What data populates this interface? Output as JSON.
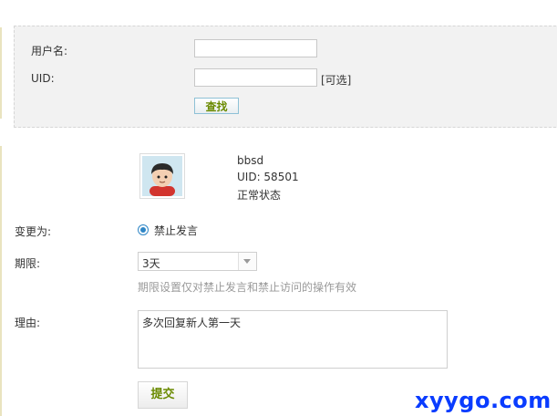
{
  "search": {
    "username_label": "用户名:",
    "username_value": "",
    "uid_label": "UID:",
    "uid_value": "",
    "uid_hint": "[可选]",
    "search_button": "查找"
  },
  "user": {
    "name": "bbsd",
    "uid": "UID: 58501",
    "status": "正常状态"
  },
  "form": {
    "change_label": "变更为:",
    "selected_action": "禁止发言",
    "period_label": "期限:",
    "period_value": "3天",
    "period_hint": "期限设置仅对禁止发言和禁止访问的操作有效",
    "reason_label": "理由:",
    "reason_value": "多次回复新人第一天",
    "submit_button": "提交"
  },
  "watermark": "xyygo.com",
  "colors": {
    "button_text": "#6a8a00",
    "accent_blue": "#2f86c6",
    "panel_bg": "#f2f2f2"
  },
  "icons": {
    "avatar": "user-avatar-icon",
    "dropdown": "chevron-down-icon"
  }
}
